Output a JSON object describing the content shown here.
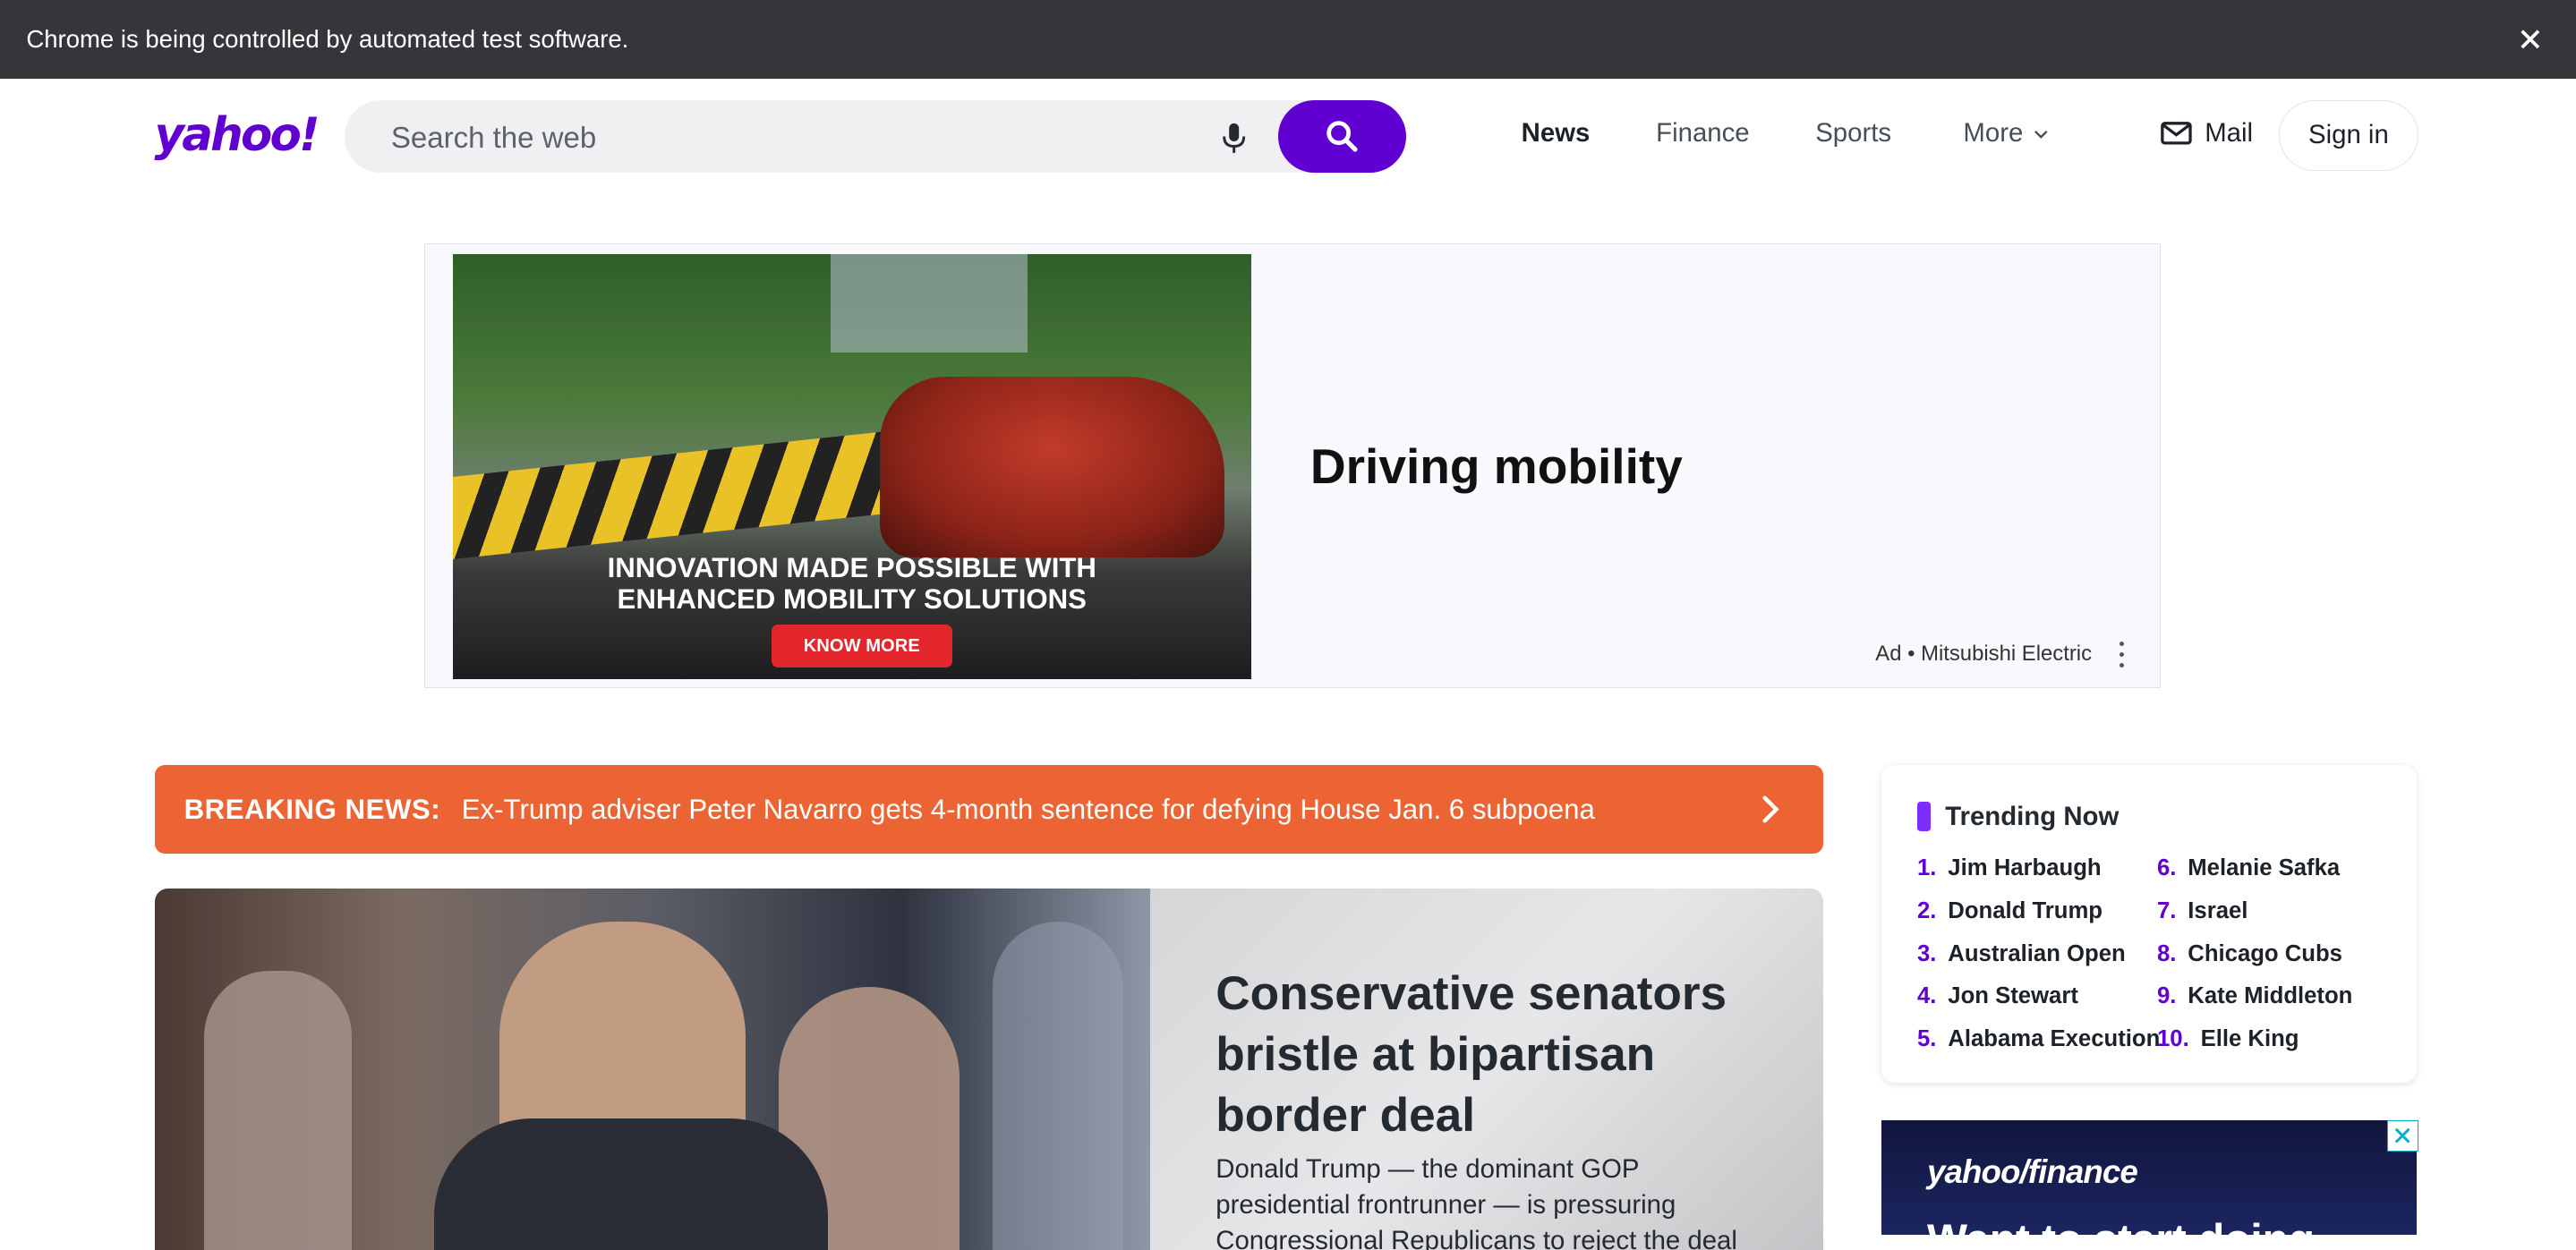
{
  "automation_bar": {
    "message": "Chrome is being controlled by automated test software.",
    "close_icon": "close-icon"
  },
  "header": {
    "logo": "yahoo!",
    "search": {
      "placeholder": "Search the web",
      "value": ""
    },
    "nav": [
      {
        "label": "News",
        "active": true
      },
      {
        "label": "Finance",
        "active": false
      },
      {
        "label": "Sports",
        "active": false
      },
      {
        "label": "More",
        "active": false
      }
    ],
    "mail_label": "Mail",
    "signin_label": "Sign in",
    "accent_color": "#6001d2"
  },
  "ad": {
    "image_line1": "INNOVATION MADE POSSIBLE WITH",
    "image_line2": "ENHANCED MOBILITY SOLUTIONS",
    "image_cta": "KNOW MORE",
    "title": "Driving mobility",
    "sponsor": "Ad • Mitsubishi Electric"
  },
  "breaking": {
    "label": "BREAKING NEWS:",
    "headline": "Ex-Trump adviser Peter Navarro gets 4-month sentence for defying House Jan. 6 subpoena",
    "color": "#ec6433"
  },
  "hero": {
    "title": "Conservative senators bristle at bipartisan border deal",
    "summary": "Donald Trump — the dominant GOP presidential frontrunner — is pressuring Congressional Republicans to reject the deal"
  },
  "trending": {
    "title": "Trending Now",
    "items": [
      {
        "rank": "1.",
        "label": "Jim Harbaugh"
      },
      {
        "rank": "2.",
        "label": "Donald Trump"
      },
      {
        "rank": "3.",
        "label": "Australian Open"
      },
      {
        "rank": "4.",
        "label": "Jon Stewart"
      },
      {
        "rank": "5.",
        "label": "Alabama Execution"
      },
      {
        "rank": "6.",
        "label": "Melanie Safka"
      },
      {
        "rank": "7.",
        "label": "Israel"
      },
      {
        "rank": "8.",
        "label": "Chicago Cubs"
      },
      {
        "rank": "9.",
        "label": "Kate Middleton"
      },
      {
        "rank": "10.",
        "label": "Elle King"
      }
    ]
  },
  "finance_ad": {
    "brand": "yahoo/finance",
    "teaser": "Want to start doing"
  }
}
